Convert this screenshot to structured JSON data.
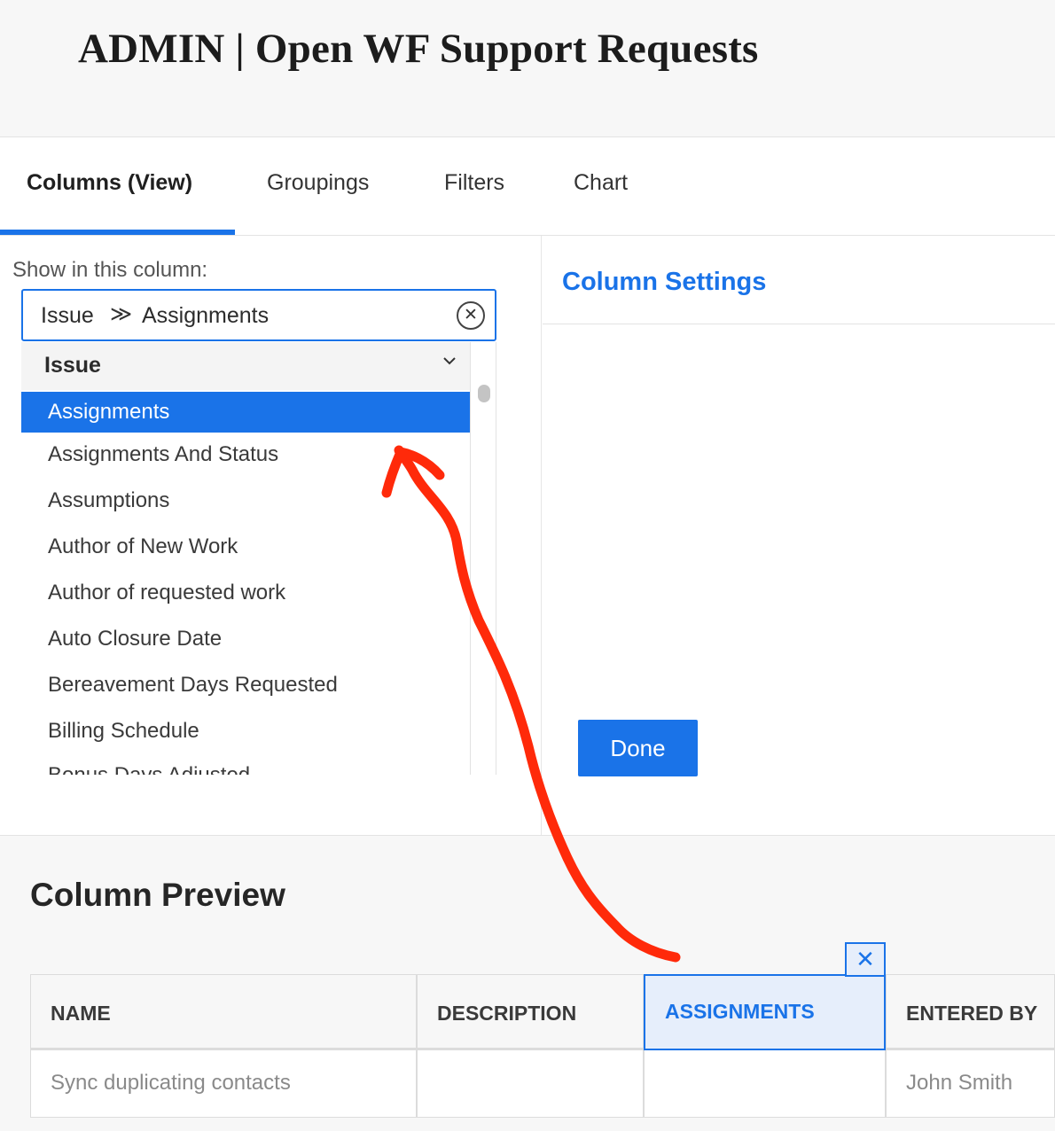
{
  "page": {
    "title": "ADMIN | Open WF Support Requests"
  },
  "tabs": [
    {
      "label": "Columns (View)",
      "active": true
    },
    {
      "label": "Groupings"
    },
    {
      "label": "Filters"
    },
    {
      "label": "Chart"
    }
  ],
  "left_panel": {
    "show_label": "Show in this column:",
    "field": {
      "object": "Issue",
      "separator": "≫",
      "field_name": "Assignments",
      "clear_icon": "circle-x-icon"
    },
    "dropdown": {
      "group_label": "Issue",
      "group_icon": "chevron-down-icon",
      "options": [
        {
          "label": "Assignments",
          "selected": true
        },
        {
          "label": "Assignments And Status"
        },
        {
          "label": "Assumptions"
        },
        {
          "label": "Author of New Work"
        },
        {
          "label": "Author of requested work"
        },
        {
          "label": "Auto Closure Date"
        },
        {
          "label": "Bereavement Days Requested"
        },
        {
          "label": "Billing Schedule"
        },
        {
          "label": "Bonus Days Adjusted"
        }
      ]
    }
  },
  "right_panel": {
    "title": "Column Settings",
    "done_label": "Done"
  },
  "preview": {
    "title": "Column Preview",
    "remove_icon": "close-icon",
    "remove_glyph": "✕",
    "columns": [
      "NAME",
      "DESCRIPTION",
      "ASSIGNMENTS",
      "ENTERED BY"
    ],
    "rows": [
      [
        "Sync duplicating contacts",
        "",
        "",
        "John Smith"
      ]
    ]
  },
  "colors": {
    "accent": "#1a73e8",
    "annotation": "#ff2a0a"
  }
}
